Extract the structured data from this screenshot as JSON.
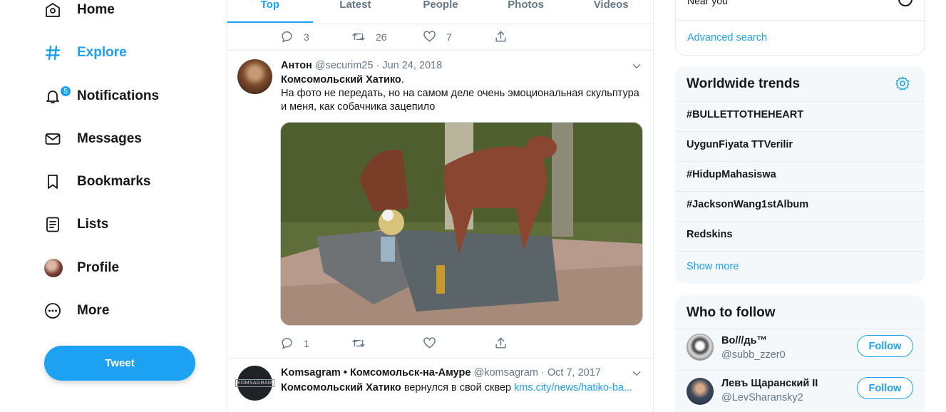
{
  "nav": {
    "items": [
      {
        "label": "Home",
        "icon": "home-icon"
      },
      {
        "label": "Explore",
        "icon": "hashtag-icon",
        "active": true
      },
      {
        "label": "Notifications",
        "icon": "bell-icon",
        "badge": "5"
      },
      {
        "label": "Messages",
        "icon": "envelope-icon"
      },
      {
        "label": "Bookmarks",
        "icon": "bookmark-icon"
      },
      {
        "label": "Lists",
        "icon": "list-icon"
      },
      {
        "label": "Profile",
        "icon": "avatar"
      },
      {
        "label": "More",
        "icon": "more-circle-icon"
      }
    ],
    "tweet_button": "Tweet"
  },
  "tabs": [
    "Top",
    "Latest",
    "People",
    "Photos",
    "Videos"
  ],
  "prev_tweet_actions": {
    "replies": "3",
    "retweets": "26",
    "likes": "7"
  },
  "tweets": [
    {
      "name": "Антон",
      "handle": "@securim25",
      "date": "Jun 24, 2018",
      "title": "Комсомольский Хатико",
      "title_suffix": ".",
      "text": "На фото не передать, но на самом деле очень эмоциональная скульптура и меня, как собачника зацепило",
      "replies": "1"
    },
    {
      "name": "Komsagram • Комсомольск-на-Амуре",
      "handle": "@komsagram",
      "date": "Oct 7, 2017",
      "title": "Комсомольский Хатико",
      "text": " вернулся в свой сквер ",
      "link": "kms.city/news/hatiko-ba...",
      "avatar_text": "KOMSAGRAM"
    }
  ],
  "search": {
    "near_you": "Near you",
    "advanced": "Advanced search"
  },
  "trends": {
    "title": "Worldwide trends",
    "items": [
      "#BULLETTOTHEHEART",
      "UygunFiyata TTVerilir",
      "#HidupMahasiswa",
      "#JacksonWang1stAlbum",
      "Redskins"
    ],
    "show_more": "Show more"
  },
  "who_to_follow": {
    "title": "Who to follow",
    "users": [
      {
        "name": "Bo///дь™",
        "handle": "@subb_zzer0",
        "button": "Follow"
      },
      {
        "name": "Левъ Щаранский II",
        "handle": "@LevSharansky2",
        "button": "Follow"
      }
    ]
  },
  "colors": {
    "accent": "#1da1f2",
    "text": "#14171a",
    "muted": "#657786",
    "border": "#e6ecf0",
    "panel": "#f5f8fa"
  }
}
